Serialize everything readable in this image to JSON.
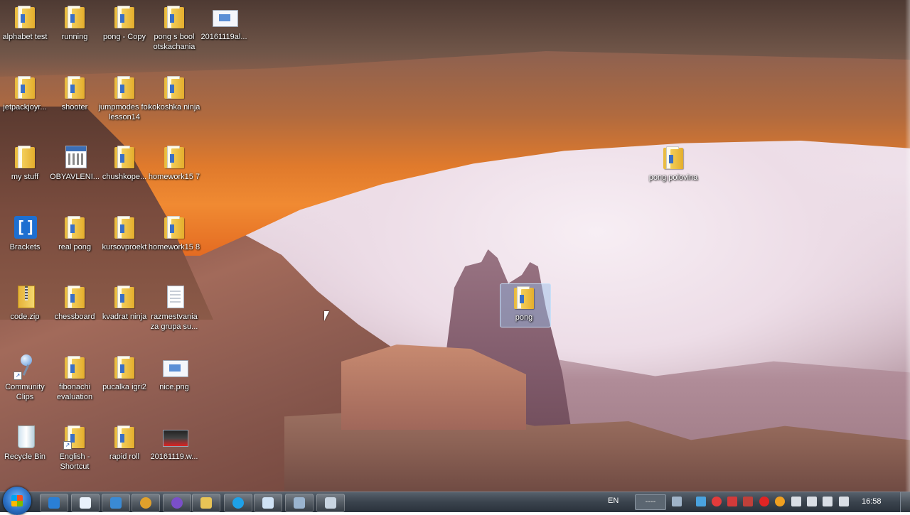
{
  "desktop": {
    "icons": [
      {
        "label": "alphabet test"
      },
      {
        "label": "running"
      },
      {
        "label": "pong - Copy"
      },
      {
        "label": "pong s bool otskachania"
      },
      {
        "label": "20161119al..."
      },
      {
        "label": "jetpackjoyr..."
      },
      {
        "label": "shooter"
      },
      {
        "label": "jumpmodes for lesson14"
      },
      {
        "label": "kokoshka ninja"
      },
      {
        "label": "my stuff"
      },
      {
        "label": "OBYAVLENI..."
      },
      {
        "label": "chushkope..."
      },
      {
        "label": "homework15 7"
      },
      {
        "label": "Brackets"
      },
      {
        "label": "real pong"
      },
      {
        "label": "kursovproekt"
      },
      {
        "label": "homework15 8"
      },
      {
        "label": "code.zip"
      },
      {
        "label": "chessboard"
      },
      {
        "label": "kvadrat ninja"
      },
      {
        "label": "razmestvania za grupa su..."
      },
      {
        "label": "Community Clips"
      },
      {
        "label": "fibonachi evaluation"
      },
      {
        "label": "pucalka igri2"
      },
      {
        "label": "nice.png"
      },
      {
        "label": "Recycle Bin"
      },
      {
        "label": "English - Shortcut"
      },
      {
        "label": "rapid roll"
      },
      {
        "label": "20161119.w..."
      },
      {
        "label": "pong polovina"
      },
      {
        "label": "pong"
      }
    ]
  },
  "taskbar": {
    "language": "EN",
    "input_box": "----",
    "clock": "16:58",
    "pinned": [
      {
        "icon": "windows-store-icon",
        "color": "#2a7fd6"
      },
      {
        "icon": "window-app-icon",
        "color": "#e9f1fb"
      },
      {
        "icon": "visual-studio-icon",
        "color": "#3a8ad4"
      },
      {
        "icon": "chrome-icon",
        "color": "#e0a12c"
      },
      {
        "icon": "viber-icon",
        "color": "#7a4fc9"
      },
      {
        "icon": "explorer-icon",
        "color": "#e8c456"
      },
      {
        "icon": "skype-icon",
        "color": "#1ea1e8"
      },
      {
        "icon": "notepad-icon",
        "color": "#cfe2f5"
      },
      {
        "icon": "control-panel-icon",
        "color": "#9ab4cf"
      },
      {
        "icon": "task-manager-icon",
        "color": "#c8d4e0"
      }
    ]
  }
}
